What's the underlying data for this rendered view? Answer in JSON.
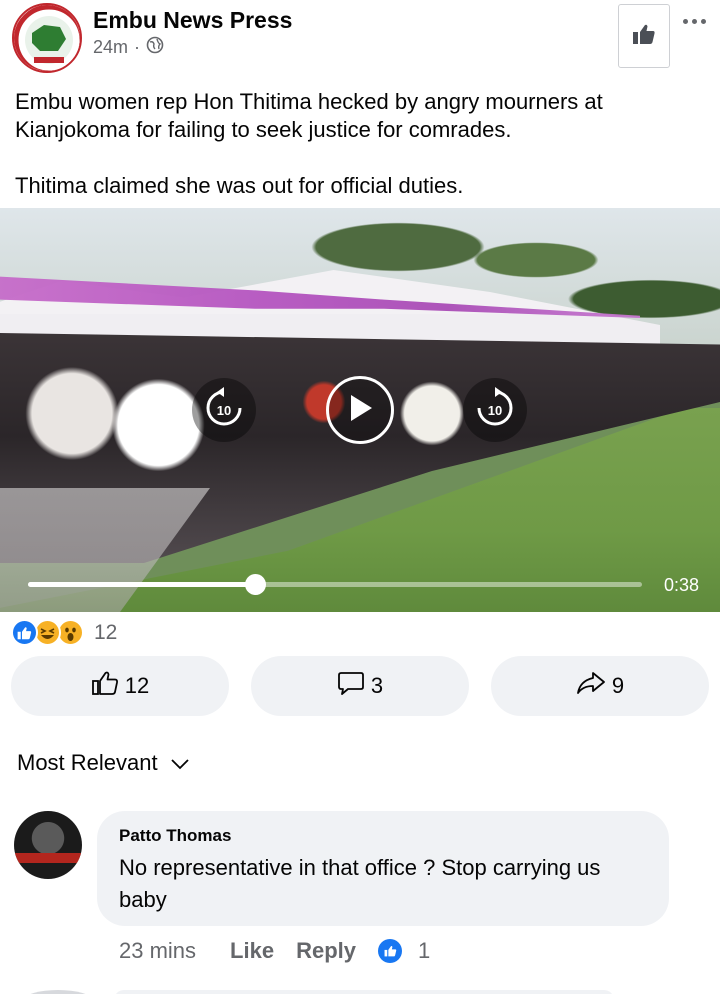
{
  "post": {
    "page_name": "Embu News Press",
    "time": "24m",
    "text_line1": "Embu women rep Hon Thitima hecked by angry mourners at Kianjokoma for failing to seek justice for comrades.",
    "text_line2": "Thitima claimed she was out for official duties."
  },
  "video": {
    "time_label": "0:38",
    "progress_fraction": 0.37,
    "rewind_seconds": "10",
    "forward_seconds": "10"
  },
  "reactions": {
    "count": "12",
    "types": [
      "like-reaction-icon",
      "haha-reaction-icon",
      "wow-reaction-icon"
    ]
  },
  "actions": {
    "like_count": "12",
    "comment_count": "3",
    "share_count": "9"
  },
  "comments": {
    "sort_label": "Most Relevant",
    "items": [
      {
        "author": "Patto Thomas",
        "text": "No representative in that office ? Stop carrying us baby",
        "time": "23 mins",
        "like_label": "Like",
        "reply_label": "Reply",
        "reaction_count": "1"
      }
    ]
  },
  "colors": {
    "accent": "#1877f2",
    "secondary_text": "#65676b",
    "button_bg": "#f0f2f5",
    "brand_red": "#c1272d"
  }
}
